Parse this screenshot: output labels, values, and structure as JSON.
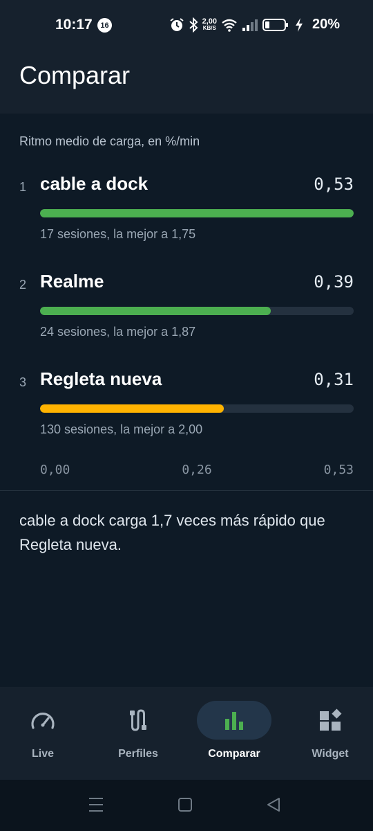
{
  "status_bar": {
    "time": "10:17",
    "notification_count": "16",
    "net_speed_value": "2,00",
    "net_speed_unit": "KB/S",
    "battery_percent": "20%"
  },
  "header": {
    "title": "Comparar"
  },
  "comparison": {
    "subtitle": "Ritmo medio de carga, en %/min",
    "max_value": 0.53,
    "rows": [
      {
        "rank": "1",
        "name": "cable a dock",
        "value_label": "0,53",
        "value": 0.53,
        "meta": "17 sesiones, la mejor a 1,75",
        "color": "#4caf50"
      },
      {
        "rank": "2",
        "name": "Realme",
        "value_label": "0,39",
        "value": 0.39,
        "meta": "24 sesiones, la mejor a 1,87",
        "color": "#4caf50"
      },
      {
        "rank": "3",
        "name": "Regleta nueva",
        "value_label": "0,31",
        "value": 0.31,
        "meta": "130 sesiones, la mejor a 2,00",
        "color": "#ffb300"
      }
    ],
    "axis": {
      "min_label": "0,00",
      "mid_label": "0,26",
      "max_label": "0,53"
    },
    "summary": "cable a dock carga 1,7 veces más rápido que Regleta nueva."
  },
  "bottom_nav": {
    "items": [
      {
        "label": "Live",
        "icon": "gauge-icon",
        "active": false
      },
      {
        "label": "Perfiles",
        "icon": "cable-icon",
        "active": false
      },
      {
        "label": "Comparar",
        "icon": "bar-chart-icon",
        "active": true
      },
      {
        "label": "Widget",
        "icon": "widget-icon",
        "active": false
      }
    ]
  },
  "colors": {
    "accent_green": "#4caf50",
    "accent_amber": "#ffb300",
    "background": "#0e1a26"
  }
}
